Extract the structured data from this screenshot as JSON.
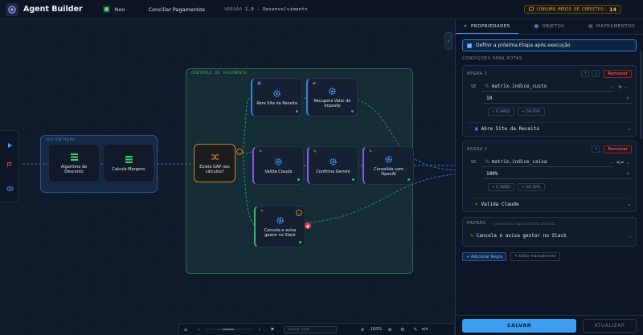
{
  "header": {
    "app_title": "Agent Builder",
    "user_name": "Neo",
    "flow_name": "Conciliar Pagamentos",
    "version_prefix": "VERSÃO",
    "version_value": "1.0 - Desenvolvimento",
    "credits_label": "CONSUMO MÉDIO DE CRÉDITOS:",
    "credits_value": "14"
  },
  "canvas": {
    "groups": {
      "sust": "SUSTENTAÇÃO",
      "ctrl": "CONTROLE DE PAGAMENTO"
    },
    "nodes": {
      "algoritmo": "Algoritmo de Desconto",
      "calcula": "Calcula Margens",
      "decision": "Existe GAP nos cálculos?",
      "abre": "Abre Site da Receita",
      "recupera": "Recupera Valor de Imposto",
      "valida": "Valida Claude",
      "confirma": "Confirma Gemini",
      "consolida": "Consolida com OpenAI",
      "cancela": "Cancela e avisa gestor no Slack"
    }
  },
  "toolbar": {
    "search_placeholder": "buscar card...",
    "zoom": "100%",
    "export_label": "e/s"
  },
  "panel": {
    "tabs": [
      "PROPRIEDADES",
      "OBJETOS",
      "MAPEAMENTOS"
    ],
    "next_step_label": "Definir a próxima Etapa após execução",
    "routes_title": "CONDIÇÕES PARA ROTAS",
    "remove_label": "Remover",
    "se_label": "SE",
    "and_label": "+ E (AND)",
    "or_label": "+ OU (OR)",
    "rules": [
      {
        "title": "REGRA 1",
        "field": "matrix.indice_custo",
        "operator": ">",
        "value": "10",
        "target": "Abre Site da Receita"
      },
      {
        "title": "REGRA 2",
        "field": "matrix.indice_caixa",
        "operator": "<=",
        "value": "100%",
        "target": "Valida Claude"
      }
    ],
    "default_title": "PADRÃO",
    "default_hint": "— se nenhuma regra acima for atendida",
    "default_target": "Cancela e avisa gestor no Slack",
    "add_rule_label": "+ Adicionar Regra",
    "manual_edit_label": "✎ Editar manualmente",
    "save_label": "SALVAR",
    "update_label": "ATUALIZAR"
  },
  "colors": {
    "accent": "#3d9ef0",
    "danger": "#e0404a",
    "success": "#2fc26b",
    "warning": "#c98a2a"
  }
}
